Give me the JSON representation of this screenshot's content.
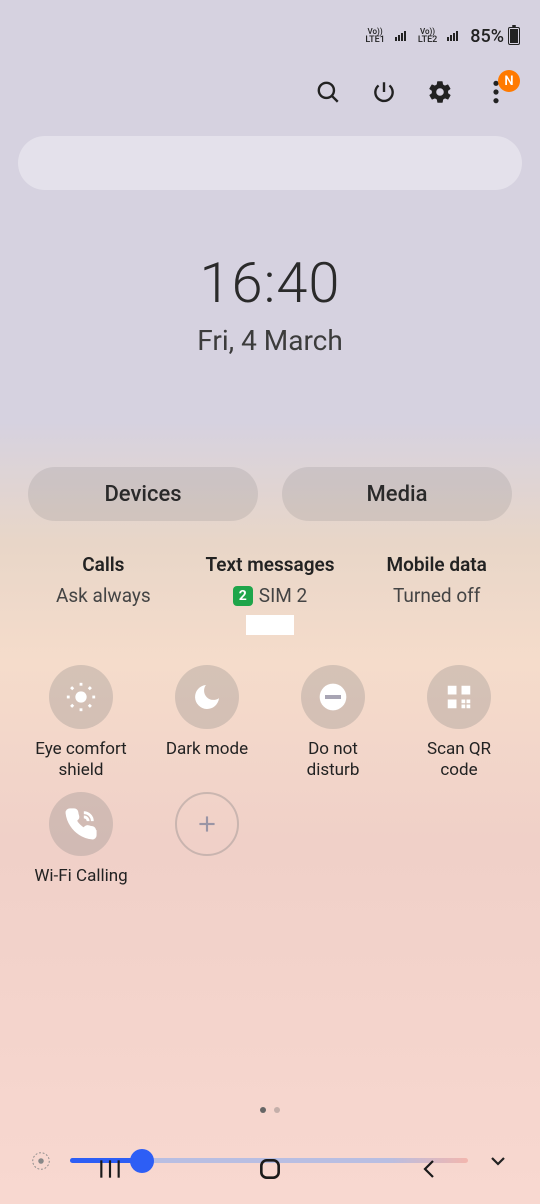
{
  "status": {
    "sim1_label": "LTE1",
    "sim2_label": "LTE2",
    "vo_label": "Vo))",
    "battery_pct": "85%"
  },
  "actions": {
    "badge_letter": "N"
  },
  "clock": {
    "time": "16:40",
    "date": "Fri, 4 March"
  },
  "chips": {
    "devices": "Devices",
    "media": "Media"
  },
  "sim": {
    "calls_title": "Calls",
    "calls_val": "Ask always",
    "texts_title": "Text messages",
    "texts_sim_num": "2",
    "texts_val": "SIM 2",
    "data_title": "Mobile data",
    "data_val": "Turned off"
  },
  "tiles": [
    {
      "label": "Eye comfort\nshield",
      "icon": "sun"
    },
    {
      "label": "Dark mode",
      "icon": "moon"
    },
    {
      "label": "Do not\ndisturb",
      "icon": "dnd"
    },
    {
      "label": "Scan QR\ncode",
      "icon": "qr"
    },
    {
      "label": "Wi-Fi Calling",
      "icon": "wificall"
    },
    {
      "label": "",
      "icon": "add"
    }
  ],
  "brightness": {
    "value_pct": 18
  }
}
